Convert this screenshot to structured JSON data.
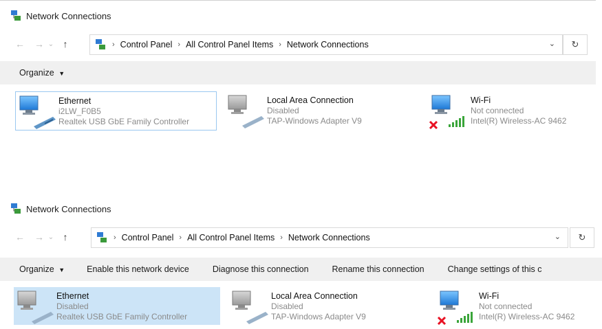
{
  "window_title": "Network Connections",
  "breadcrumb": [
    "Control Panel",
    "All Control Panel Items",
    "Network Connections"
  ],
  "top_panel": {
    "commands": [
      "Organize"
    ],
    "adapters": [
      {
        "name": "Ethernet",
        "status": "i2LW_F0B5",
        "device": "Realtek USB GbE Family Controller"
      },
      {
        "name": "Local Area Connection",
        "status": "Disabled",
        "device": "TAP-Windows Adapter V9"
      },
      {
        "name": "Wi-Fi",
        "status": "Not connected",
        "device": "Intel(R) Wireless-AC 9462"
      }
    ]
  },
  "bottom_panel": {
    "commands": [
      "Organize",
      "Enable this network device",
      "Diagnose this connection",
      "Rename this connection",
      "Change settings of this c"
    ],
    "adapters": [
      {
        "name": "Ethernet",
        "status": "Disabled",
        "device": "Realtek USB GbE Family Controller"
      },
      {
        "name": "Local Area Connection",
        "status": "Disabled",
        "device": "TAP-Windows Adapter V9"
      },
      {
        "name": "Wi-Fi",
        "status": "Not connected",
        "device": "Intel(R) Wireless-AC 9462"
      }
    ]
  },
  "icons": {
    "title": "network-connections-icon",
    "back": "back-arrow-icon",
    "forward": "forward-arrow-icon",
    "recent": "recent-locations-chevron-icon",
    "up": "up-arrow-icon",
    "dropdown": "chevron-down-icon",
    "refresh": "refresh-icon",
    "organize": "dropdown-caret-icon",
    "disconnected": "red-x-icon",
    "signal": "wifi-signal-bars-icon"
  },
  "colors": {
    "accent_selected": "#cce4f7",
    "focus_border": "#9ac7f0",
    "command_bar": "#f0f0f0",
    "disconnected": "#e81123",
    "signal": "#3aa53a"
  }
}
